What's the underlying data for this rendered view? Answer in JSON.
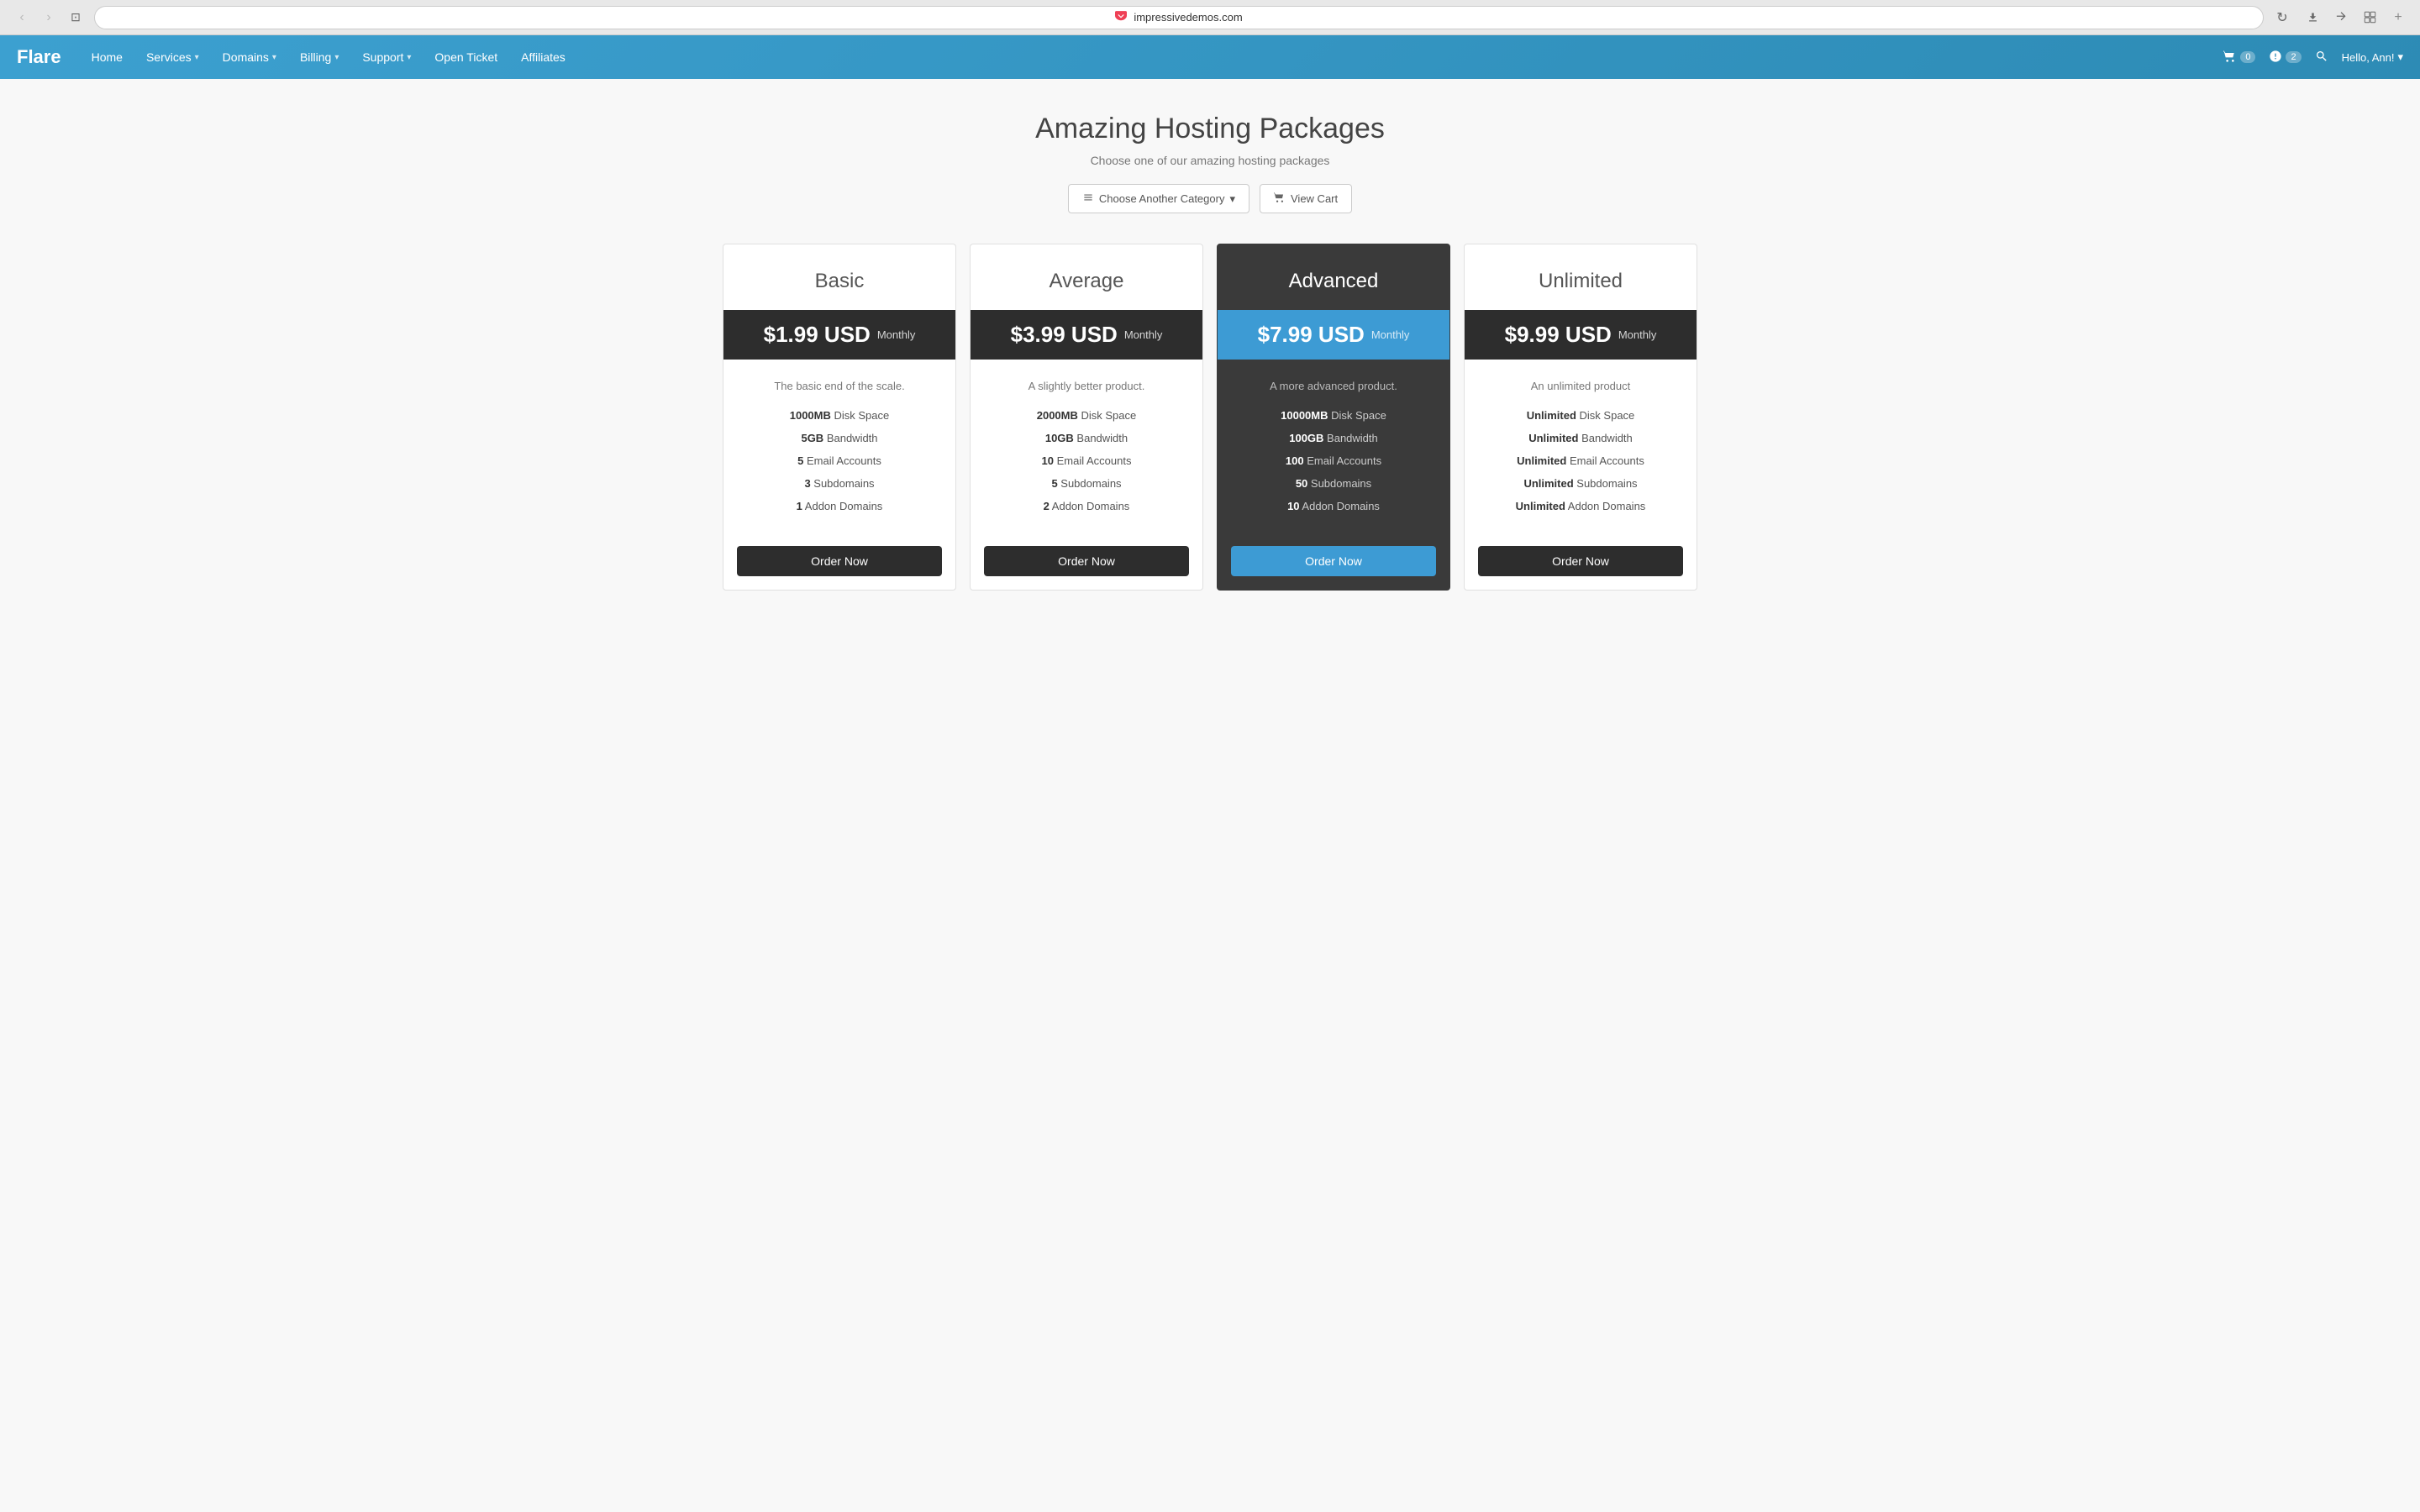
{
  "browser": {
    "url": "impressivedemos.com",
    "pocket_icon": "❯",
    "back_btn": "‹",
    "forward_btn": "›",
    "sidebar_btn": "⊡",
    "reload_btn": "↻",
    "download_icon": "⬇",
    "share_icon": "⬆",
    "tab_icon": "⧉",
    "plus_icon": "+"
  },
  "navbar": {
    "brand": "Flare",
    "items": [
      {
        "label": "Home",
        "has_dropdown": false
      },
      {
        "label": "Services",
        "has_dropdown": true
      },
      {
        "label": "Domains",
        "has_dropdown": true
      },
      {
        "label": "Billing",
        "has_dropdown": true
      },
      {
        "label": "Support",
        "has_dropdown": true
      },
      {
        "label": "Open Ticket",
        "has_dropdown": false
      },
      {
        "label": "Affiliates",
        "has_dropdown": false
      }
    ],
    "cart_count": "0",
    "notifications_count": "2",
    "greeting": "Hello, Ann!"
  },
  "page": {
    "title": "Amazing Hosting Packages",
    "subtitle": "Choose one of our amazing hosting packages",
    "choose_category_btn": "Choose Another Category",
    "view_cart_btn": "View Cart"
  },
  "plans": [
    {
      "id": "basic",
      "name": "Basic",
      "price": "$1.99 USD",
      "period": "Monthly",
      "description": "The basic end of the scale.",
      "featured": false,
      "features": [
        {
          "value": "1000MB",
          "label": "Disk Space"
        },
        {
          "value": "5GB",
          "label": "Bandwidth"
        },
        {
          "value": "5",
          "label": "Email Accounts"
        },
        {
          "value": "3",
          "label": "Subdomains"
        },
        {
          "value": "1",
          "label": "Addon Domains"
        }
      ],
      "order_btn": "Order Now"
    },
    {
      "id": "average",
      "name": "Average",
      "price": "$3.99 USD",
      "period": "Monthly",
      "description": "A slightly better product.",
      "featured": false,
      "features": [
        {
          "value": "2000MB",
          "label": "Disk Space"
        },
        {
          "value": "10GB",
          "label": "Bandwidth"
        },
        {
          "value": "10",
          "label": "Email Accounts"
        },
        {
          "value": "5",
          "label": "Subdomains"
        },
        {
          "value": "2",
          "label": "Addon Domains"
        }
      ],
      "order_btn": "Order Now"
    },
    {
      "id": "advanced",
      "name": "Advanced",
      "price": "$7.99 USD",
      "period": "Monthly",
      "description": "A more advanced product.",
      "featured": true,
      "features": [
        {
          "value": "10000MB",
          "label": "Disk Space"
        },
        {
          "value": "100GB",
          "label": "Bandwidth"
        },
        {
          "value": "100",
          "label": "Email Accounts"
        },
        {
          "value": "50",
          "label": "Subdomains"
        },
        {
          "value": "10",
          "label": "Addon Domains"
        }
      ],
      "order_btn": "Order Now"
    },
    {
      "id": "unlimited",
      "name": "Unlimited",
      "price": "$9.99 USD",
      "period": "Monthly",
      "description": "An unlimited product",
      "featured": false,
      "features": [
        {
          "value": "Unlimited",
          "label": "Disk Space"
        },
        {
          "value": "Unlimited",
          "label": "Bandwidth"
        },
        {
          "value": "Unlimited",
          "label": "Email Accounts"
        },
        {
          "value": "Unlimited",
          "label": "Subdomains"
        },
        {
          "value": "Unlimited",
          "label": "Addon Domains"
        }
      ],
      "order_btn": "Order Now"
    }
  ]
}
